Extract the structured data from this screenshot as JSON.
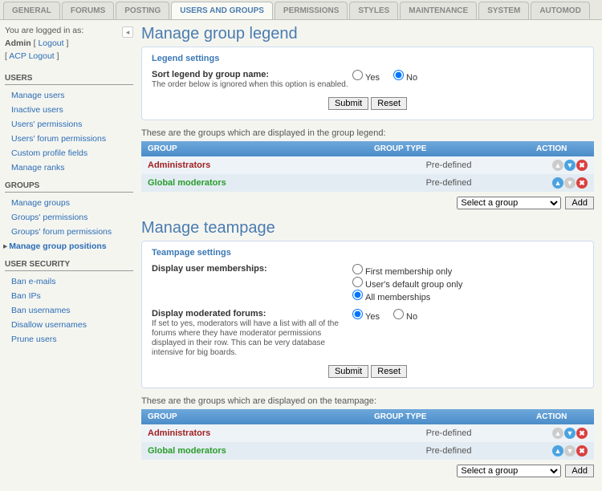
{
  "tabs": [
    "GENERAL",
    "FORUMS",
    "POSTING",
    "USERS AND GROUPS",
    "PERMISSIONS",
    "STYLES",
    "MAINTENANCE",
    "SYSTEM",
    "AUTOMOD"
  ],
  "active_tab": 3,
  "login": {
    "prefix": "You are logged in as:",
    "user": "Admin",
    "logout": "Logout",
    "acp_logout": "ACP Logout"
  },
  "sidebar": [
    {
      "header": "USERS",
      "items": [
        "Manage users",
        "Inactive users",
        "Users' permissions",
        "Users' forum permissions",
        "Custom profile fields",
        "Manage ranks"
      ],
      "active": -1
    },
    {
      "header": "GROUPS",
      "items": [
        "Manage groups",
        "Groups' permissions",
        "Groups' forum permissions",
        "Manage group positions"
      ],
      "active": 3
    },
    {
      "header": "USER SECURITY",
      "items": [
        "Ban e-mails",
        "Ban IPs",
        "Ban usernames",
        "Disallow usernames",
        "Prune users"
      ],
      "active": -1
    }
  ],
  "section1": {
    "title": "Manage group legend",
    "legend": "Legend settings",
    "sort_label": "Sort legend by group name:",
    "sort_help": "The order below is ignored when this option is enabled.",
    "yes": "Yes",
    "no": "No",
    "submit": "Submit",
    "reset": "Reset",
    "table_desc": "These are the groups which are displayed in the group legend:",
    "col_group": "GROUP",
    "col_type": "GROUP TYPE",
    "col_action": "ACTION",
    "rows": [
      {
        "name": "Administrators",
        "cls": "g-admin",
        "type": "Pre-defined",
        "up": false,
        "down": true
      },
      {
        "name": "Global moderators",
        "cls": "g-mod",
        "type": "Pre-defined",
        "up": true,
        "down": false
      }
    ],
    "select_placeholder": "Select a group",
    "add": "Add"
  },
  "section2": {
    "title": "Manage teampage",
    "legend": "Teampage settings",
    "memb_label": "Display user memberships:",
    "memb_opts": [
      "First membership only",
      "User's default group only",
      "All memberships"
    ],
    "memb_selected": 2,
    "mod_label": "Display moderated forums:",
    "mod_help": "If set to yes, moderators will have a list with all of the forums where they have moderator permissions displayed in their row. This can be very database intensive for big boards.",
    "yes": "Yes",
    "no": "No",
    "submit": "Submit",
    "reset": "Reset",
    "table_desc": "These are the groups which are displayed on the teampage:",
    "col_group": "GROUP",
    "col_type": "GROUP TYPE",
    "col_action": "ACTION",
    "rows": [
      {
        "name": "Administrators",
        "cls": "g-admin",
        "type": "Pre-defined",
        "up": false,
        "down": true
      },
      {
        "name": "Global moderators",
        "cls": "g-mod",
        "type": "Pre-defined",
        "up": true,
        "down": false
      }
    ],
    "select_placeholder": "Select a group",
    "add": "Add"
  }
}
